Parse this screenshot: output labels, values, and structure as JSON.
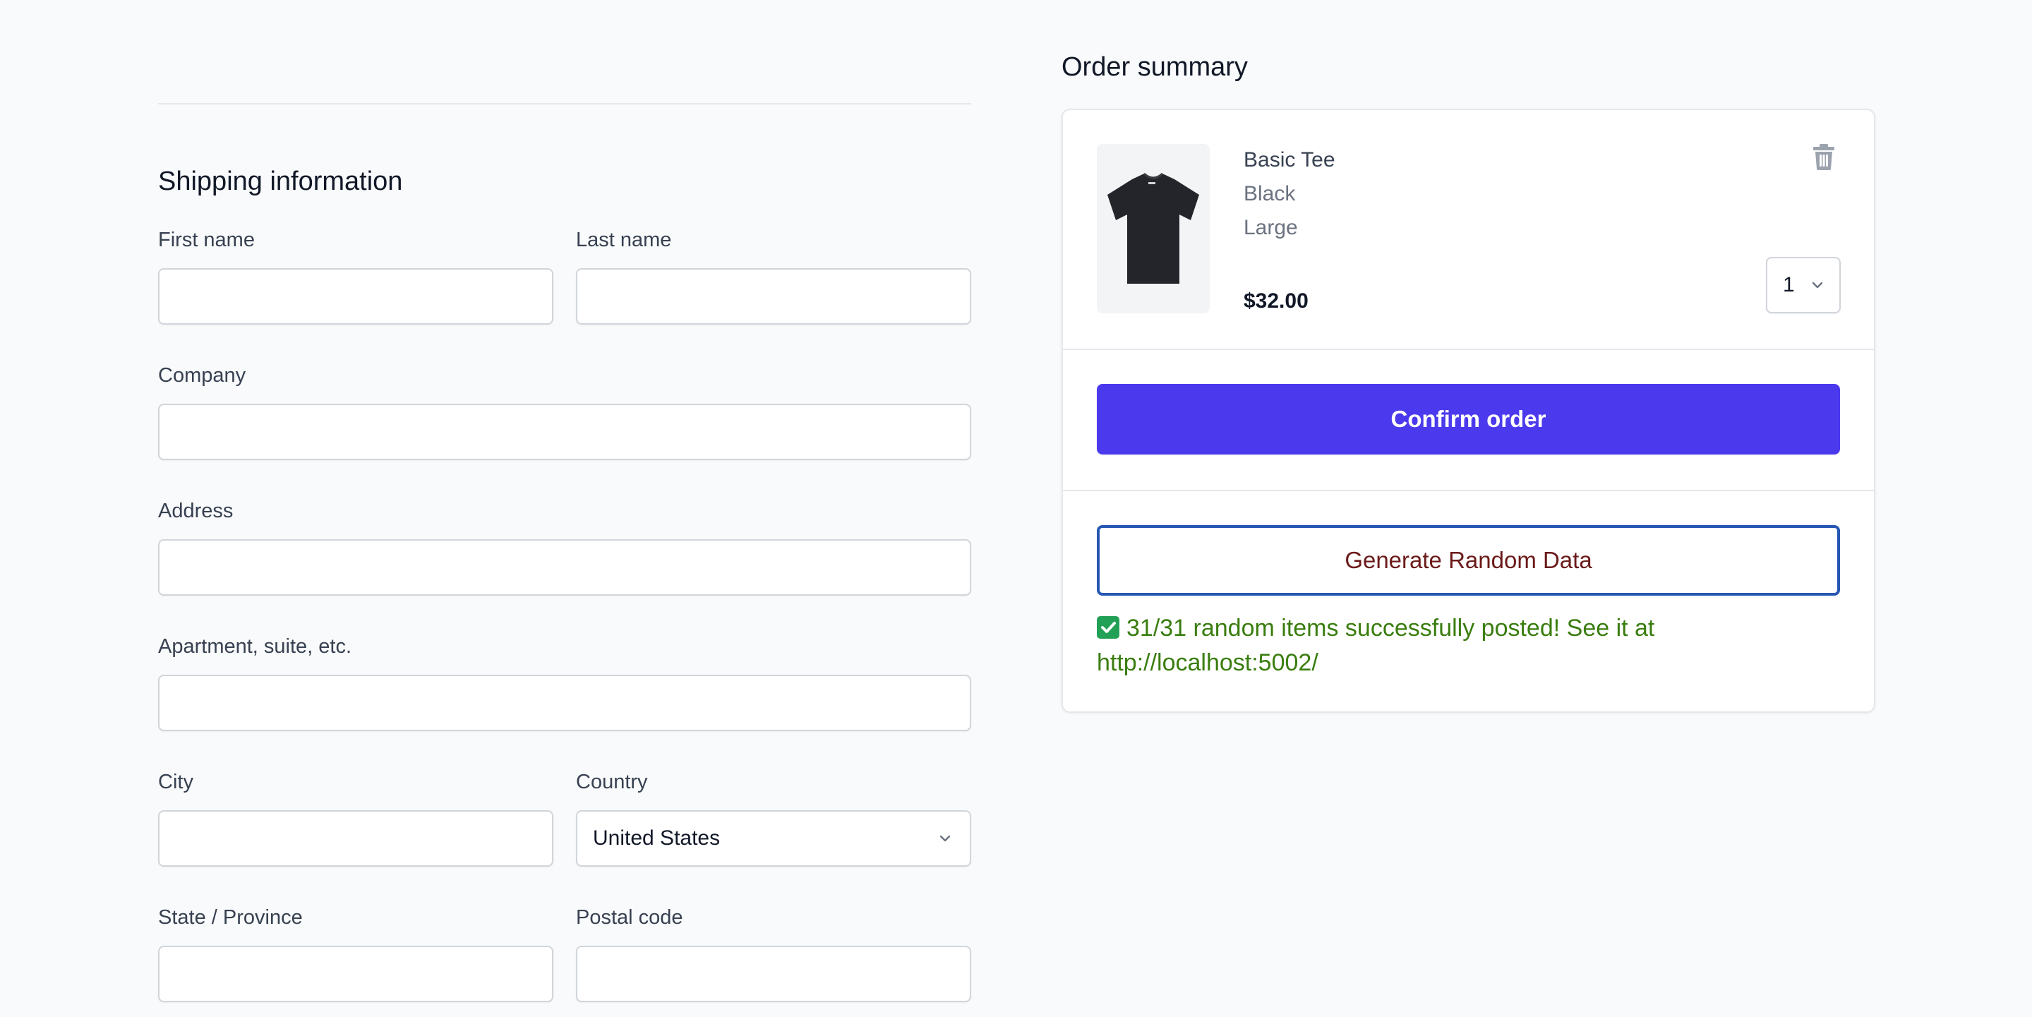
{
  "shipping": {
    "title": "Shipping information",
    "first_name_label": "First name",
    "last_name_label": "Last name",
    "company_label": "Company",
    "address_label": "Address",
    "apartment_label": "Apartment, suite, etc.",
    "city_label": "City",
    "country_label": "Country",
    "country_value": "United States",
    "state_label": "State / Province",
    "postal_label": "Postal code"
  },
  "order": {
    "title": "Order summary",
    "item": {
      "name": "Basic Tee",
      "color": "Black",
      "size": "Large",
      "price": "$32.00",
      "quantity": "1",
      "image_icon": "black-tshirt-image"
    },
    "confirm_label": "Confirm order",
    "generate_label": "Generate Random Data",
    "status_message": "31/31 random items successfully posted! See it at http://localhost:5002/"
  },
  "colors": {
    "accent": "#4b3aed",
    "success": "#3a7d0f",
    "generate_text": "#6b1a1a",
    "generate_border": "#2557b3"
  }
}
